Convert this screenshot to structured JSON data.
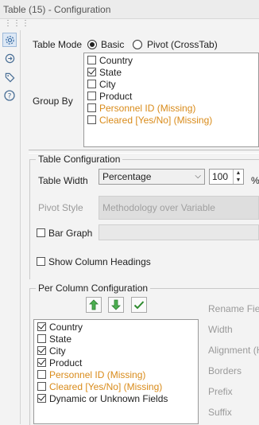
{
  "window": {
    "title": "Table (15) - Configuration"
  },
  "sidebar": {
    "icons": [
      "gear-icon",
      "connection-icon",
      "tag-icon",
      "help-icon"
    ]
  },
  "table_mode": {
    "label": "Table Mode",
    "options": [
      {
        "label": "Basic",
        "selected": true
      },
      {
        "label": "Pivot (CrossTab)",
        "selected": false
      }
    ]
  },
  "group_by": {
    "label": "Group By",
    "items": [
      {
        "label": "Country",
        "checked": false,
        "missing": false
      },
      {
        "label": "State",
        "checked": true,
        "missing": false
      },
      {
        "label": "City",
        "checked": false,
        "missing": false
      },
      {
        "label": "Product",
        "checked": false,
        "missing": false
      },
      {
        "label": "Personnel ID (Missing)",
        "checked": false,
        "missing": true
      },
      {
        "label": "Cleared [Yes/No] (Missing)",
        "checked": false,
        "missing": true
      }
    ]
  },
  "table_config": {
    "title": "Table Configuration",
    "width_label": "Table Width",
    "width_value": "Percentage",
    "width_number": "100",
    "width_unit": "%",
    "pivot_style_label": "Pivot Style",
    "pivot_style_value": "Methodology over Variable",
    "bar_graph_label": "Bar Graph",
    "bar_graph_checked": false,
    "show_headings_label": "Show Column Headings",
    "show_headings_checked": false
  },
  "per_column": {
    "title": "Per Column Configuration",
    "toolbar": [
      "move-up-icon",
      "move-down-icon",
      "check-all-icon"
    ],
    "items": [
      {
        "label": "Country",
        "checked": true,
        "missing": false
      },
      {
        "label": "State",
        "checked": false,
        "missing": false
      },
      {
        "label": "City",
        "checked": true,
        "missing": false
      },
      {
        "label": "Product",
        "checked": true,
        "missing": false
      },
      {
        "label": "Personnel ID (Missing)",
        "checked": false,
        "missing": true
      },
      {
        "label": "Cleared [Yes/No] (Missing)",
        "checked": false,
        "missing": true
      },
      {
        "label": "Dynamic or Unknown Fields",
        "checked": true,
        "missing": false
      }
    ],
    "properties": [
      "Rename Field",
      "Width",
      "Alignment (H)",
      "Borders",
      "Prefix",
      "Suffix"
    ]
  },
  "colors": {
    "accent": "#2e8b2e",
    "missing": "#d98b1a",
    "muted": "#9a9a9a"
  }
}
